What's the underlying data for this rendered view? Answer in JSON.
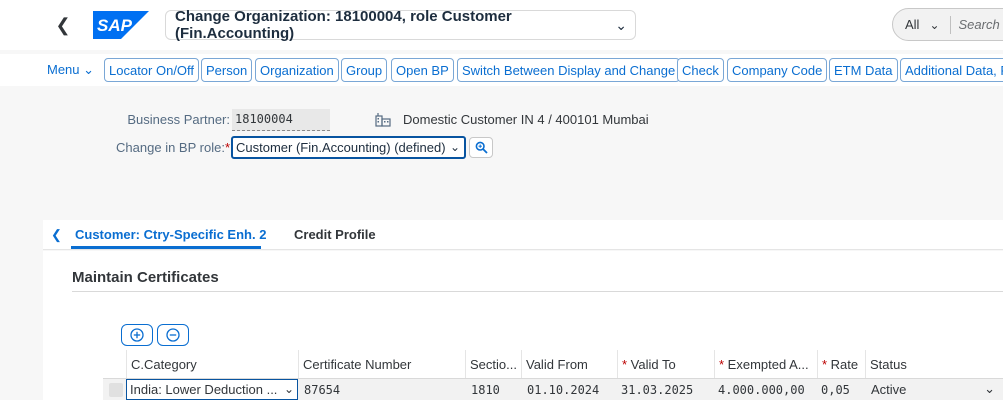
{
  "shell": {
    "title": "Change Organization: 18100004, role Customer (Fin.Accounting)",
    "search_scope": "All",
    "search_placeholder": "Search",
    "brand_colors": {
      "sap_blue": "#0a6ed1",
      "logo_blue": "#0070f2"
    }
  },
  "toolbar": {
    "menu_label": "Menu",
    "buttons": [
      "Locator On/Off",
      "Person",
      "Organization",
      "Group",
      "Open BP",
      "Switch Between Display and Change",
      "Check",
      "Company Code",
      "ETM Data",
      "Additional Data, F"
    ]
  },
  "form": {
    "bp_label": "Business Partner:",
    "bp_value": "18100004",
    "bp_description": "Domestic Customer IN 4 / 400101 Mumbai",
    "role_label": "Change in BP role:",
    "role_required_marker": "*",
    "role_value": "Customer (Fin.Accounting) (defined)"
  },
  "tabs": [
    {
      "label": "Customer: Ctry-Specific Enh. 2",
      "active": true
    },
    {
      "label": "Credit Profile",
      "active": false
    }
  ],
  "section": {
    "title": "Maintain Certificates"
  },
  "table": {
    "columns": [
      {
        "label": "C.Category",
        "required": false
      },
      {
        "label": "Certificate Number",
        "required": false
      },
      {
        "label": "Sectio...",
        "required": false
      },
      {
        "label": "Valid From",
        "required": false
      },
      {
        "label": "Valid To",
        "required": true
      },
      {
        "label": "Exempted A...",
        "required": true
      },
      {
        "label": "Rate",
        "required": true
      },
      {
        "label": "Status",
        "required": false
      }
    ],
    "rows": [
      {
        "category": "India: Lower Deduction ...",
        "certificate_number": "87654",
        "section": "1810",
        "valid_from": "01.10.2024",
        "valid_to": "31.03.2025",
        "exempted_amount": "4.000.000,00",
        "rate": "0,05",
        "status": "Active"
      }
    ]
  }
}
